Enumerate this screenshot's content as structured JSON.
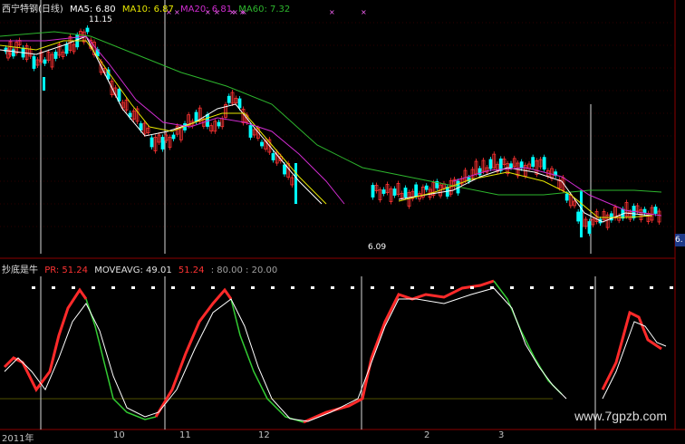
{
  "main_panel": {
    "title": "西宁特钢(日线)",
    "ma5": "MA5: 6.80",
    "ma10": "MA10: 6.87",
    "ma20": "MA20: 6.81",
    "ma60": "MA60: 7.32",
    "high_label": "11.15",
    "low_label": "6.09",
    "price_tag": "6.",
    "colors": {
      "ma5": "#ffffff",
      "ma10": "#e6e600",
      "ma20": "#d02cd0",
      "ma60": "#2db52d",
      "up": "#ff3333",
      "down": "#00ffff"
    }
  },
  "indicator_panel": {
    "name": "抄底是牛",
    "pr": "PR: 51.24",
    "moveavg": "MOVEAVG: 49.01",
    "val3": "51.24",
    "thresholds": ": 80.00 : 20.00"
  },
  "x_axis": {
    "labels": [
      "2011年",
      "10",
      "11",
      "12",
      "2",
      "3"
    ]
  },
  "watermark": "www.7gpzb.com"
}
